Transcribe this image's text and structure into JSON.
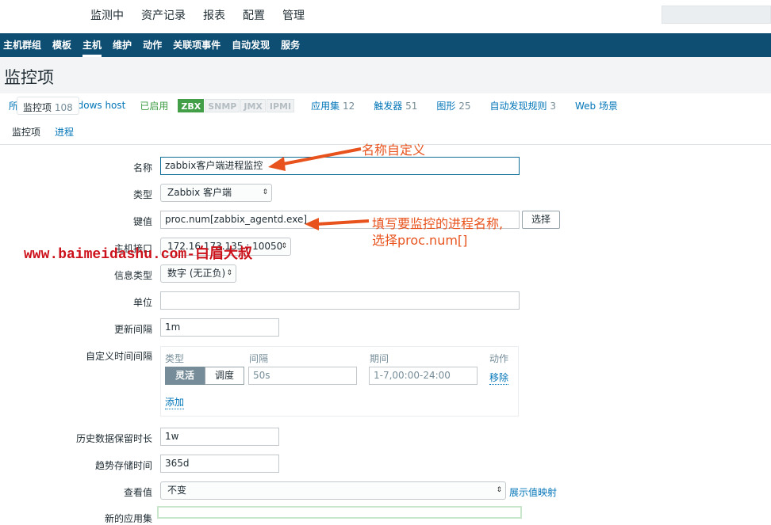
{
  "top_menu": [
    "监测中",
    "资产记录",
    "报表",
    "配置",
    "管理"
  ],
  "sub_menu": [
    "主机群组",
    "模板",
    "主机",
    "维护",
    "动作",
    "关联项事件",
    "自动发现",
    "服务"
  ],
  "page_title": "监控项",
  "breadcrumb": {
    "all_hosts": "所有主机",
    "sep": "/",
    "host": "Windows host",
    "enabled": "已启用",
    "badges": [
      "ZBX",
      "SNMP",
      "JMX",
      "IPMI"
    ],
    "apps": "应用集",
    "apps_n": "12",
    "items": "监控项",
    "items_n": "108",
    "triggers": "触发器",
    "triggers_n": "51",
    "graphs": "图形",
    "graphs_n": "25",
    "discovery": "自动发现规则",
    "discovery_n": "3",
    "web": "Web 场景"
  },
  "tabs": [
    "监控项",
    "进程"
  ],
  "form": {
    "name_label": "名称",
    "name_value": "zabbix客户端进程监控",
    "type_label": "类型",
    "type_value": "Zabbix 客户端",
    "key_label": "键值",
    "key_value": "proc.num[zabbix_agentd.exe]",
    "select_button": "选择",
    "iface_label": "主机接口",
    "iface_value": "172.16.173.135 : 10050",
    "info_type_label": "信息类型",
    "info_type_value": "数字 (无正负)",
    "units_label": "单位",
    "units_value": "",
    "interval_label": "更新间隔",
    "interval_value": "1m",
    "custom_label": "自定义时间间隔",
    "custom": {
      "h_type": "类型",
      "h_interval": "间隔",
      "h_period": "期间",
      "h_action": "动作",
      "flexible": "灵活",
      "scheduling": "调度",
      "interval_placeholder": "50s",
      "period_placeholder": "1-7,00:00-24:00",
      "remove": "移除",
      "add": "添加"
    },
    "history_label": "历史数据保留时长",
    "history_value": "1w",
    "trends_label": "趋势存储时间",
    "trends_value": "365d",
    "showvalue_label": "查看值",
    "showvalue_value": "不变",
    "showvalue_link": "展示值映射",
    "newapp_label": "新的应用集"
  },
  "annotations": {
    "a1": "名称自定义",
    "a2_line1": "填写要监控的进程名称,",
    "a2_line2": "选择proc.num[]"
  },
  "watermark": "www.baimeidashu.com-白眉大叔",
  "colors": {
    "accent": "#0275b8",
    "nav": "#0e4e73",
    "annotation": "#e8531d",
    "watermark": "#cc1019"
  }
}
